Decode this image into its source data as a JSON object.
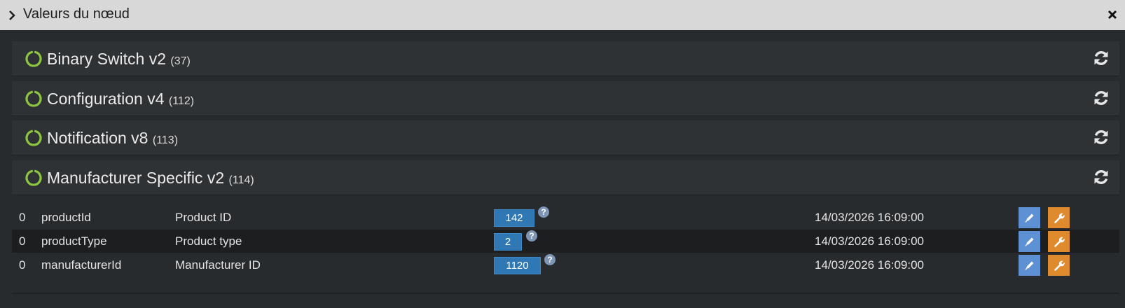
{
  "window": {
    "title": "Valeurs du nœud"
  },
  "command_classes": [
    {
      "name": "Binary Switch v2",
      "id": "(37)"
    },
    {
      "name": "Configuration v4",
      "id": "(112)"
    },
    {
      "name": "Notification v8",
      "id": "(113)"
    },
    {
      "name": "Manufacturer Specific v2",
      "id": "(114)"
    }
  ],
  "values": [
    {
      "index": "0",
      "key": "productId",
      "label": "Product ID",
      "value": "142",
      "help": "?",
      "date": "14/03/2026 16:09:00"
    },
    {
      "index": "0",
      "key": "productType",
      "label": "Product type",
      "value": "2",
      "help": "?",
      "date": "14/03/2026 16:09:00"
    },
    {
      "index": "0",
      "key": "manufacturerId",
      "label": "Manufacturer ID",
      "value": "1120",
      "help": "?",
      "date": "14/03/2026 16:09:00"
    }
  ],
  "colors": {
    "status_ok": "#8cc63f",
    "value_bg": "#2f78b4",
    "edit_btn": "#5e91d4",
    "config_btn": "#e08a2e"
  },
  "icons": {
    "collapse": "chevron-right-icon",
    "close": "close-icon",
    "status": "circle-notch-icon",
    "refresh": "refresh-icon",
    "edit": "pencil-icon",
    "config": "wrench-icon",
    "help": "question-circle-icon"
  }
}
